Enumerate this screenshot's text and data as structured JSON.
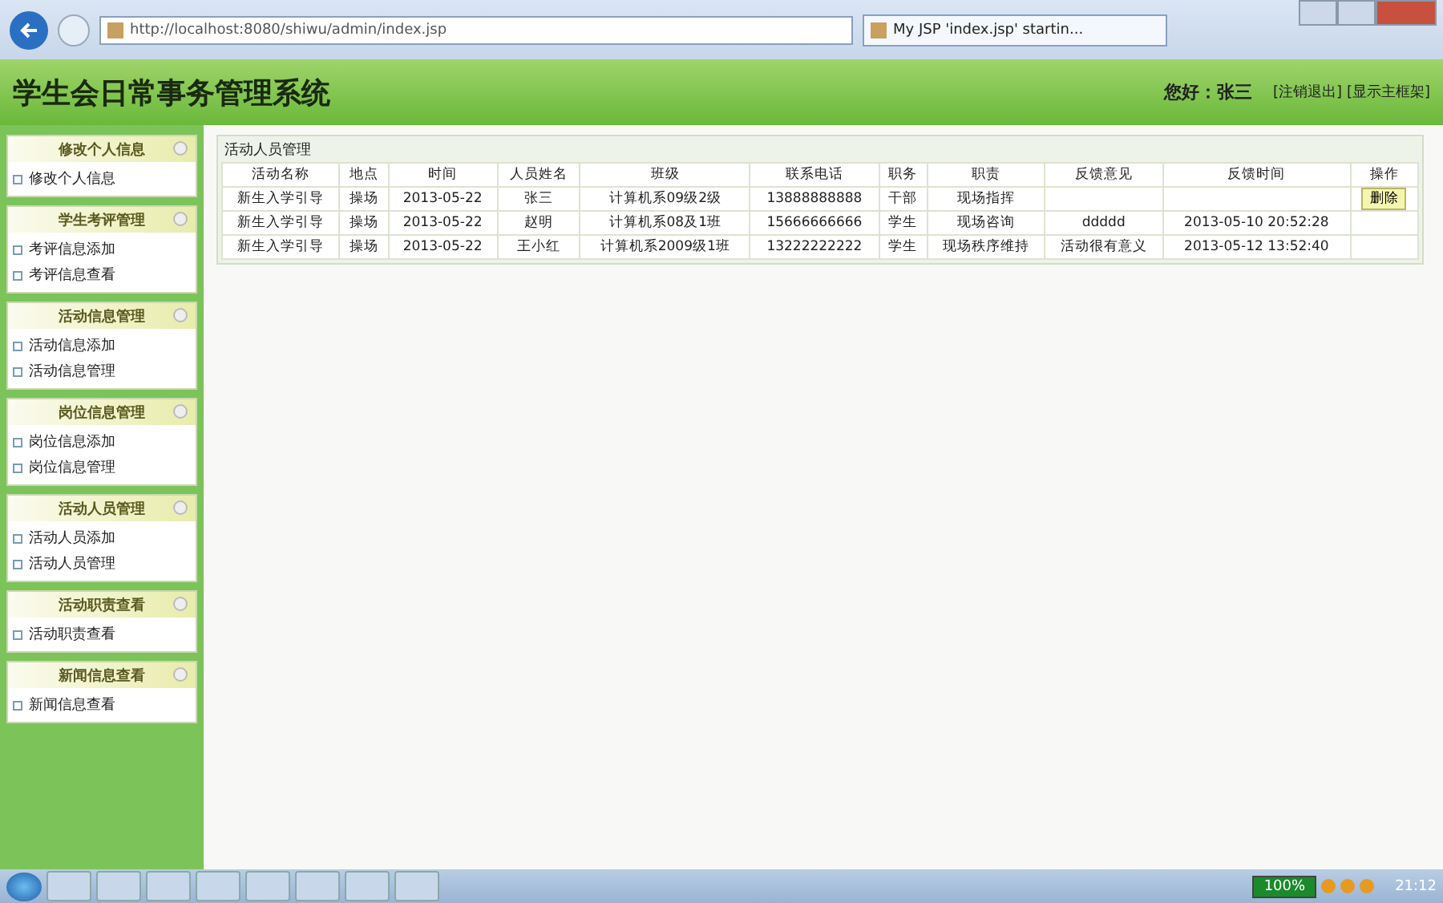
{
  "browser": {
    "address": "http://localhost:8080/shiwu/admin/index.jsp",
    "tab": "My JSP 'index.jsp' startin..."
  },
  "header": {
    "title": "学生会日常事务管理系统",
    "greeting": "您好：张三",
    "links": [
      "[注销退出]",
      "[显示主框架]"
    ]
  },
  "sidebar": {
    "sections": [
      {
        "title": "修改个人信息",
        "items": [
          "修改个人信息"
        ]
      },
      {
        "title": "学生考评管理",
        "items": [
          "考评信息添加",
          "考评信息查看"
        ]
      },
      {
        "title": "活动信息管理",
        "items": [
          "活动信息添加",
          "活动信息管理"
        ]
      },
      {
        "title": "岗位信息管理",
        "items": [
          "岗位信息添加",
          "岗位信息管理"
        ]
      },
      {
        "title": "活动人员管理",
        "items": [
          "活动人员添加",
          "活动人员管理"
        ]
      },
      {
        "title": "活动职责查看",
        "items": [
          "活动职责查看"
        ]
      },
      {
        "title": "新闻信息查看",
        "items": [
          "新闻信息查看"
        ]
      }
    ]
  },
  "panel": {
    "title": "活动人员管理",
    "table": {
      "columns": [
        "活动名称",
        "地点",
        "时间",
        "人员姓名",
        "班级",
        "联系电话",
        "职务",
        "职责",
        "反馈意见",
        "反馈时间",
        "操作"
      ],
      "rows": [
        {
          "cells": [
            "新生入学引导",
            "操场",
            "2013-05-22",
            "张三",
            "计算机系09级2级",
            "13888888888",
            "干部",
            "现场指挥",
            "",
            ""
          ],
          "action": "删除"
        },
        {
          "cells": [
            "新生入学引导",
            "操场",
            "2013-05-22",
            "赵明",
            "计算机系08及1班",
            "15666666666",
            "学生",
            "现场咨询",
            "ddddd",
            "2013-05-10 20:52:28"
          ]
        },
        {
          "cells": [
            "新生入学引导",
            "操场",
            "2013-05-22",
            "王小红",
            "计算机系2009级1班",
            "13222222222",
            "学生",
            "现场秩序维持",
            "活动很有意义",
            "2013-05-12 13:52:40"
          ]
        }
      ]
    }
  },
  "taskbar": {
    "battery": "100%",
    "clock": "21:12"
  }
}
